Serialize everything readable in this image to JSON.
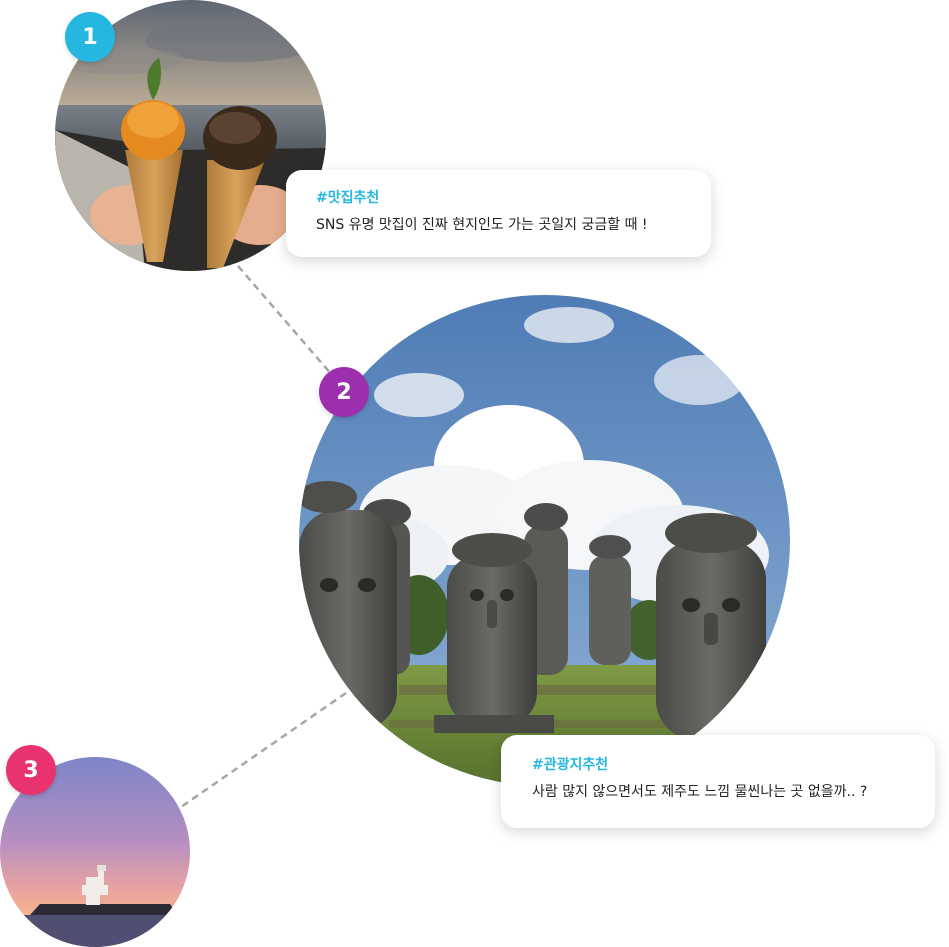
{
  "items": [
    {
      "number": "1",
      "hashtag": "#맛집추천",
      "message": "SNS 유명 맛집이 진짜 현지인도 가는 곳일지 궁금할 때 !",
      "badge_color": "#25b7e0"
    },
    {
      "number": "2",
      "hashtag": "#관광지추천",
      "message": "사람 많지 않으면서도 제주도 느낌 물씬나는 곳 없을까.. ?",
      "badge_color": "#9b2fae"
    },
    {
      "number": "3",
      "badge_color": "#e8336f"
    }
  ],
  "colors": {
    "hashtag": "#25b7e0",
    "connector": "#a6a6a6"
  }
}
